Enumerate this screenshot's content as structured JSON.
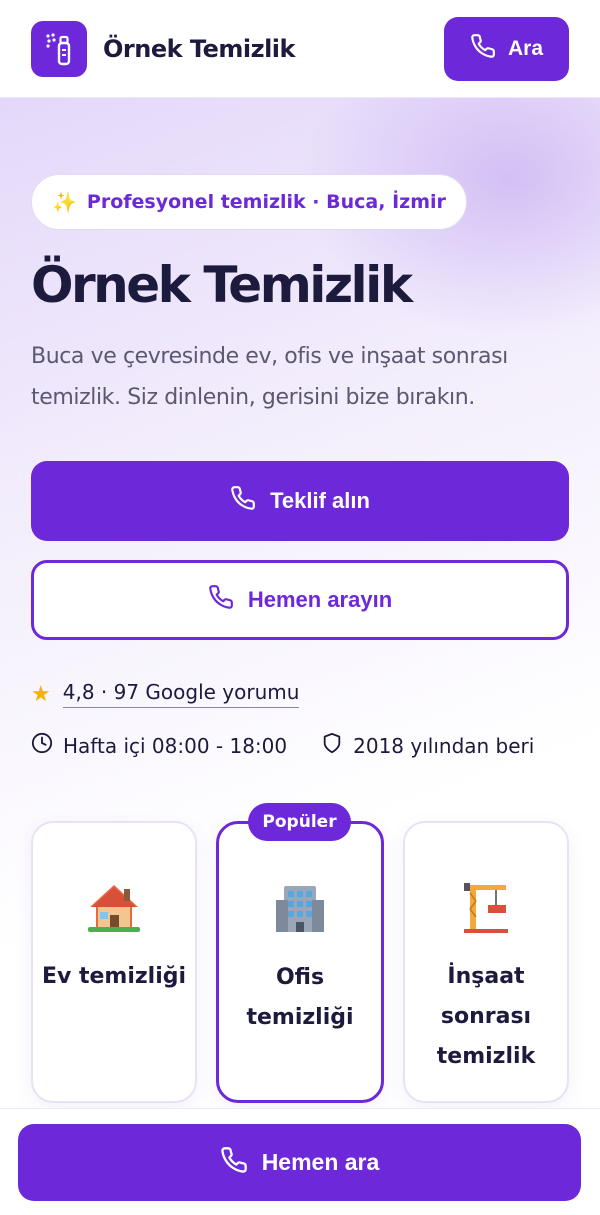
{
  "header": {
    "brand_name": "Örnek Temizlik",
    "logo_icon": "spray-bottle-icon",
    "call_label": "Ara"
  },
  "hero": {
    "pill_icon": "sparkles",
    "pill_text": "Profesyonel temizlik · Buca, İzmir",
    "title": "Örnek Temizlik",
    "description": "Buca ve çevresinde ev, ofis ve inşaat sonrası temizlik. Siz dinlenin, gerisini bize bırakın.",
    "primary_cta": "Teklif alın",
    "secondary_cta": "Hemen arayın",
    "rating_text": "4,8 · 97 Google yorumu",
    "hours": "Hafta içi 08:00 - 18:00",
    "since": "2018 yılından beri"
  },
  "services": {
    "badge": "Popüler",
    "items": [
      {
        "title": "Ev temizliği",
        "icon": "house-icon"
      },
      {
        "title": "Ofis temizliği",
        "icon": "office-building-icon"
      },
      {
        "title": "İnşaat sonrası temizlik",
        "icon": "construction-crane-icon"
      }
    ]
  },
  "footer": {
    "cta": "Hemen ara"
  },
  "colors": {
    "accent": "#6d28d9",
    "text": "#1c1a3d",
    "muted": "#5b5870",
    "star": "#f5b301"
  }
}
